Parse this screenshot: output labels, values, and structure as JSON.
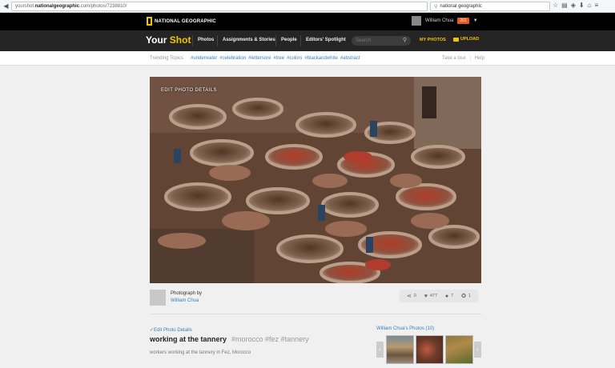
{
  "browser": {
    "url_prefix": "yourshot.",
    "url_domain": "nationalgeographic",
    "url_suffix": ".com/photos/7238810/",
    "search_query": "national geographic"
  },
  "header": {
    "brand": "NATIONAL GEOGRAPHIC",
    "user_name": "William Chua",
    "notification_count": "201"
  },
  "nav": {
    "logo_your": "Your",
    "logo_shot": "Shot",
    "items": [
      "Photos",
      "Assignments & Stories",
      "People",
      "Editors' Spotlight"
    ],
    "search_placeholder": "Search",
    "my_photos": "MY PHOTOS",
    "upload": "UPLOAD"
  },
  "trending": {
    "label": "Trending Topics",
    "tags": [
      "#underwater",
      "#celebration",
      "#lettersore",
      "#tree",
      "#colors",
      "#blackandwhite",
      "#abstract"
    ],
    "take_tour": "Take a tour",
    "separator": "|",
    "help": "Help"
  },
  "photo": {
    "overlay_label": "EDIT PHOTO DETAILS",
    "photograph_by": "Photograph by",
    "author": "William Chua",
    "stats": {
      "shares": "0",
      "likes": "477",
      "comments": "7",
      "awards": "1"
    },
    "edit_details": "✓Edit Photo Details",
    "title": "working at the tannery",
    "tags": "#morocco #fez #tannery",
    "caption": "workers working at the tannery in Fez, Morocco"
  },
  "sidebar": {
    "heading": "William Chua's Photos (10)"
  },
  "colors": {
    "accent": "#f5c400",
    "link": "#3a7fc0",
    "badge": "#e45a1f"
  }
}
